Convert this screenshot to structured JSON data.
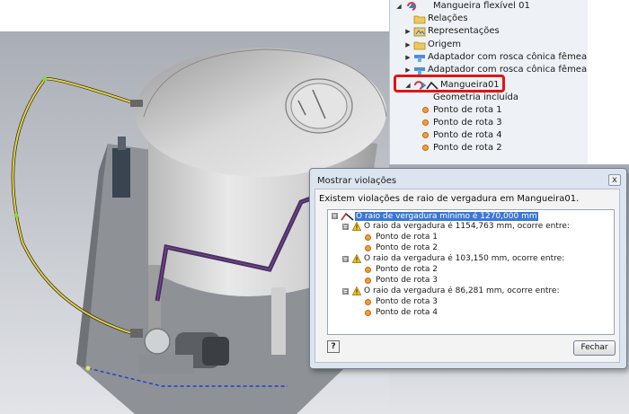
{
  "browser": {
    "rows": [
      {
        "label": "Mangueira flexível 01"
      },
      {
        "label": "Relações"
      },
      {
        "label": "Representações"
      },
      {
        "label": "Origem"
      },
      {
        "label": "Adaptador com rosca cônica fêmea Park"
      },
      {
        "label": "Adaptador com rosca cônica fêmea Park"
      },
      {
        "label": "Mangueira01"
      },
      {
        "label": "Geometria incluída"
      },
      {
        "label": "Ponto de rota 1"
      },
      {
        "label": "Ponto de rota 3"
      },
      {
        "label": "Ponto de rota 4"
      },
      {
        "label": "Ponto de rota 2"
      }
    ]
  },
  "dialog": {
    "title": "Mostrar violações",
    "close": "x",
    "message": "Existem violações de raio de vergadura em Mangueira01.",
    "root": "O raio de vergadura mínimo é 1270,000 mm",
    "groups": [
      {
        "text": "O raio da vergadura é 1154,763 mm, ocorre entre:",
        "points": [
          "Ponto de rota 1",
          "Ponto de rota 2"
        ]
      },
      {
        "text": "O raio da vergadura é 103,150 mm, ocorre entre:",
        "points": [
          "Ponto de rota 2",
          "Ponto de rota 3"
        ]
      },
      {
        "text": "O raio da vergadura é 86,281 mm, ocorre entre:",
        "points": [
          "Ponto de rota 3",
          "Ponto de rota 4"
        ]
      }
    ],
    "expanded_symbol": "⊟",
    "help_label": "?",
    "close_button": "Fechar"
  }
}
